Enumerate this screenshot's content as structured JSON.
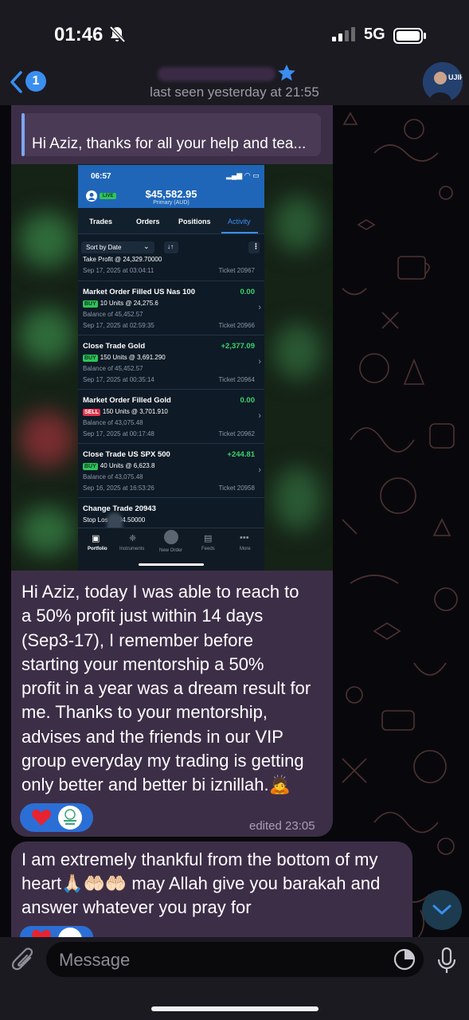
{
  "status_bar": {
    "time": "01:46",
    "network": "5G"
  },
  "header": {
    "back_count": "1",
    "last_seen": "last seen yesterday at 21:55"
  },
  "reply": {
    "text": "Hi Aziz, thanks for all your help and tea..."
  },
  "screenshot": {
    "time": "06:57",
    "live": "LIVE",
    "balance": "$45,582.95",
    "account": "Primary (AUD)",
    "tabs": [
      "Trades",
      "Orders",
      "Positions",
      "Activity"
    ],
    "sort": "Sort by Date",
    "top_partial": {
      "title": "Take Profit @ 24,329.70000",
      "date": "Sep 17, 2025 at 03:04:11",
      "ticket": "Ticket 20967"
    },
    "items": [
      {
        "title": "Market Order Filled US Nas 100",
        "amount": "0.00",
        "side": "BUY",
        "units": "10 Units @ 24,275.6",
        "balance": "Balance of 45,452.57",
        "date": "Sep 17, 2025 at 02:59:35",
        "ticket": "Ticket 20966"
      },
      {
        "title": "Close Trade Gold",
        "amount": "+2,377.09",
        "side": "BUY",
        "units": "150 Units @ 3,691.290",
        "balance": "Balance of 45,452.57",
        "date": "Sep 17, 2025 at 00:35:14",
        "ticket": "Ticket 20964"
      },
      {
        "title": "Market Order Filled Gold",
        "amount": "0.00",
        "side": "SELL",
        "units": "150 Units @ 3,701.910",
        "balance": "Balance of 43,075.48",
        "date": "Sep 17, 2025 at 00:17:48",
        "ticket": "Ticket 20962"
      },
      {
        "title": "Close Trade US SPX 500",
        "amount": "+244.81",
        "side": "BUY",
        "units": "40 Units @ 6,623.8",
        "balance": "Balance of 43,075.48",
        "date": "Sep 16, 2025 at 16:53:26",
        "ticket": "Ticket 20958"
      }
    ],
    "bottom_partial": {
      "title": "Change Trade 20943",
      "line": "Stop Los  3,634.50000"
    },
    "nav": [
      "Portfolio",
      "Instruments",
      "New Order",
      "Feeds",
      "More"
    ]
  },
  "message1": {
    "lines": [
      "Hi Aziz, today I was able to reach to",
      "a 50% profit just within 14 days",
      "(Sep3-17), I remember before",
      "starting your mentorship a 50%",
      "profit in a year was a dream result for",
      "me. Thanks to your mentorship,",
      "advises and the friends in our VIP",
      "group everyday my trading is getting",
      "only better and better bi iznillah.🙇"
    ],
    "edited": "edited 23:05"
  },
  "message2": {
    "lines": [
      "I am extremely thankful from the bottom of my",
      "heart🙏🏻🤲🏻🤲🏻 may Allah give you barakah and",
      "answer whatever you pray for"
    ]
  },
  "input": {
    "placeholder": "Message"
  },
  "colors": {
    "accent": "#3a8ef0",
    "bubble": "#3d2e48",
    "profit": "#3ad46a",
    "sell": "#e0344b"
  }
}
